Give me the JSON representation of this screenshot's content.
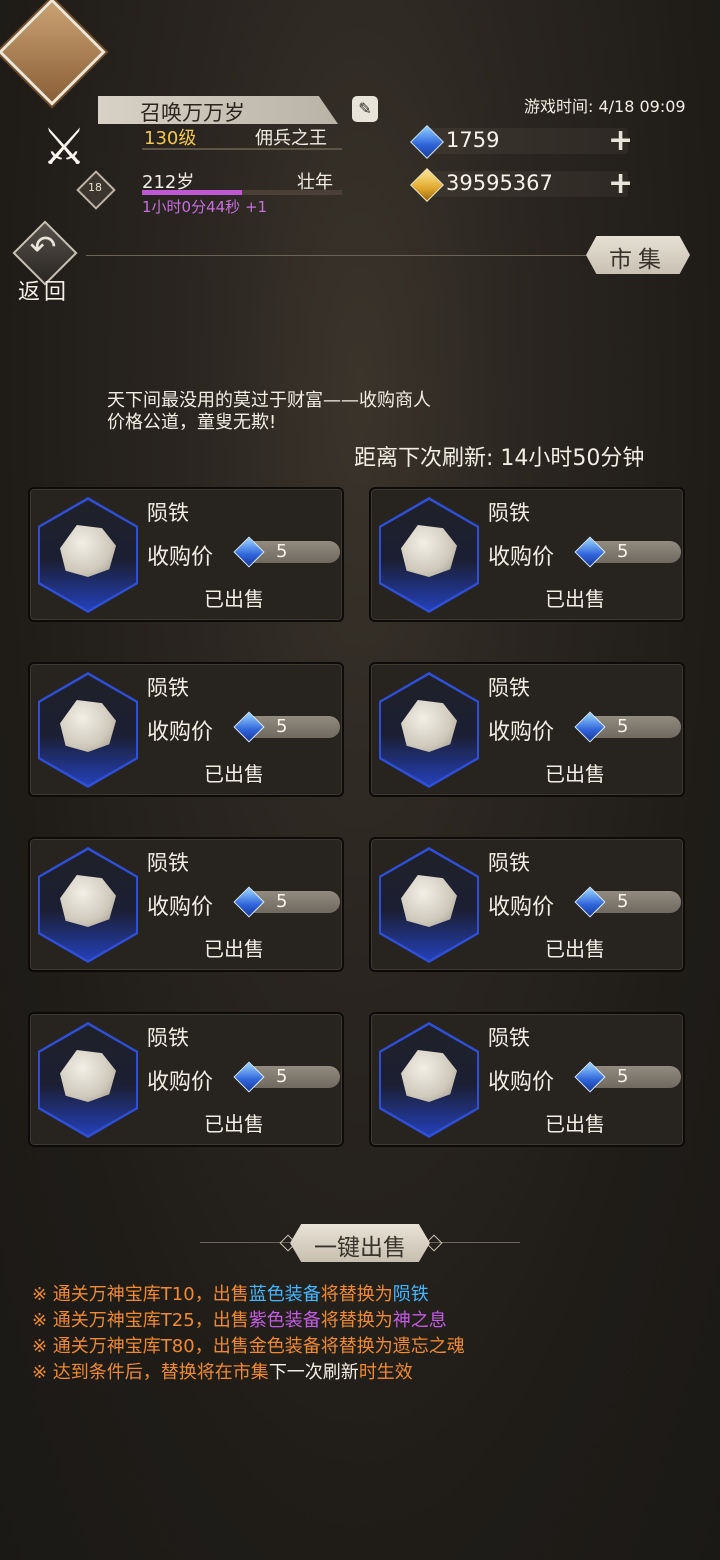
{
  "player": {
    "name": "召唤万万岁",
    "level": "130级",
    "title": "佣兵之王",
    "age": "212岁",
    "stage": "壮年",
    "timer": "1小时0分44秒 +1",
    "badge_level": "18",
    "age_progress": 0.5
  },
  "game_time": "游戏时间: 4/18 09:09",
  "resources": {
    "gems": "1759",
    "gold": "39595367"
  },
  "nav": {
    "back_label": "返回",
    "market_tab": "市集"
  },
  "shop": {
    "slogan_line1": "天下间最没用的莫过于财富——收购商人",
    "slogan_line2": "价格公道，童叟无欺!",
    "refresh": "距离下次刷新: 14小时50分钟",
    "price_label": "收购价",
    "items": [
      {
        "name": "陨铁",
        "price": "5",
        "status": "已出售"
      },
      {
        "name": "陨铁",
        "price": "5",
        "status": "已出售"
      },
      {
        "name": "陨铁",
        "price": "5",
        "status": "已出售"
      },
      {
        "name": "陨铁",
        "price": "5",
        "status": "已出售"
      },
      {
        "name": "陨铁",
        "price": "5",
        "status": "已出售"
      },
      {
        "name": "陨铁",
        "price": "5",
        "status": "已出售"
      },
      {
        "name": "陨铁",
        "price": "5",
        "status": "已出售"
      },
      {
        "name": "陨铁",
        "price": "5",
        "status": "已出售"
      }
    ],
    "sell_all": "一键出售"
  },
  "notes": [
    {
      "parts": [
        {
          "t": "※ 通关万神宝库T10，出售",
          "c": "orange"
        },
        {
          "t": "蓝色装备",
          "c": "blue"
        },
        {
          "t": "将替换为",
          "c": "orange"
        },
        {
          "t": "陨铁",
          "c": "blue"
        }
      ]
    },
    {
      "parts": [
        {
          "t": "※ 通关万神宝库T25，出售",
          "c": "orange"
        },
        {
          "t": "紫色装备",
          "c": "purple"
        },
        {
          "t": "将替换为",
          "c": "orange"
        },
        {
          "t": "神之息",
          "c": "purple"
        }
      ]
    },
    {
      "parts": [
        {
          "t": "※ 通关万神宝库T80，出售金色装备将替换为遗忘之魂",
          "c": "orange"
        }
      ]
    },
    {
      "parts": [
        {
          "t": "※ 达到条件后，替换将在市集",
          "c": "orange"
        },
        {
          "t": "下一次刷新",
          "c": "white"
        },
        {
          "t": "时生效",
          "c": "orange"
        }
      ]
    }
  ],
  "colors": {
    "accent_gold": "#f2c84a",
    "timer_purple": "#c86ee0",
    "note_orange": "#e8a832",
    "note_blue": "#44b6ff",
    "note_purple": "#c25ce0"
  }
}
